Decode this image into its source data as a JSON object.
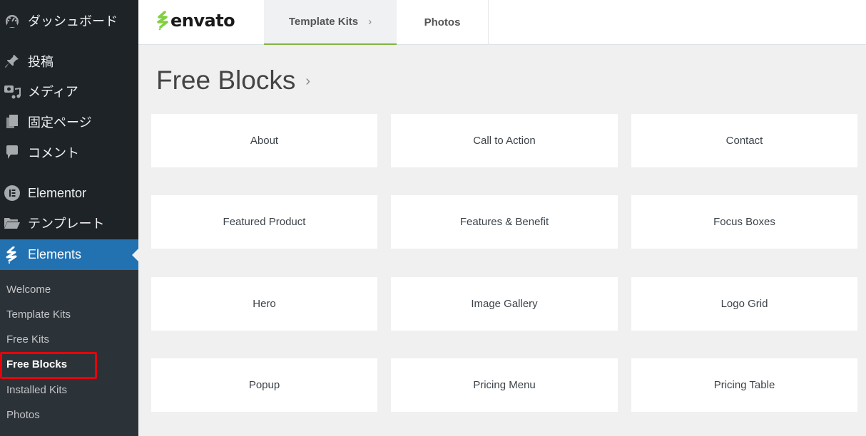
{
  "sidebar": {
    "items": [
      {
        "label": "ダッシュボード",
        "icon": "dashboard-icon"
      },
      {
        "label": "投稿",
        "icon": "pin-icon"
      },
      {
        "label": "メディア",
        "icon": "media-icon"
      },
      {
        "label": "固定ページ",
        "icon": "pages-icon"
      },
      {
        "label": "コメント",
        "icon": "comment-icon"
      },
      {
        "label": "Elementor",
        "icon": "elementor-icon"
      },
      {
        "label": "テンプレート",
        "icon": "folder-icon"
      },
      {
        "label": "Elements",
        "icon": "envato-elements-icon",
        "active": true
      }
    ],
    "submenu": [
      {
        "label": "Welcome"
      },
      {
        "label": "Template Kits"
      },
      {
        "label": "Free Kits"
      },
      {
        "label": "Free Blocks",
        "current": true
      },
      {
        "label": "Installed Kits"
      },
      {
        "label": "Photos"
      }
    ]
  },
  "header": {
    "logo_text": "envato",
    "tabs": [
      {
        "label": "Template Kits",
        "active": true
      },
      {
        "label": "Photos"
      }
    ]
  },
  "main": {
    "title": "Free Blocks",
    "blocks": [
      {
        "label": "About"
      },
      {
        "label": "Call to Action"
      },
      {
        "label": "Contact"
      },
      {
        "label": "Featured Product"
      },
      {
        "label": "Features & Benefit"
      },
      {
        "label": "Focus Boxes"
      },
      {
        "label": "Hero"
      },
      {
        "label": "Image Gallery"
      },
      {
        "label": "Logo Grid"
      },
      {
        "label": "Popup"
      },
      {
        "label": "Pricing Menu"
      },
      {
        "label": "Pricing Table"
      }
    ]
  },
  "colors": {
    "sidebar_bg": "#1d2327",
    "submenu_bg": "#2c3338",
    "active_blue": "#2271b1",
    "envato_green": "#82b440",
    "highlight_red": "#e8000b"
  }
}
